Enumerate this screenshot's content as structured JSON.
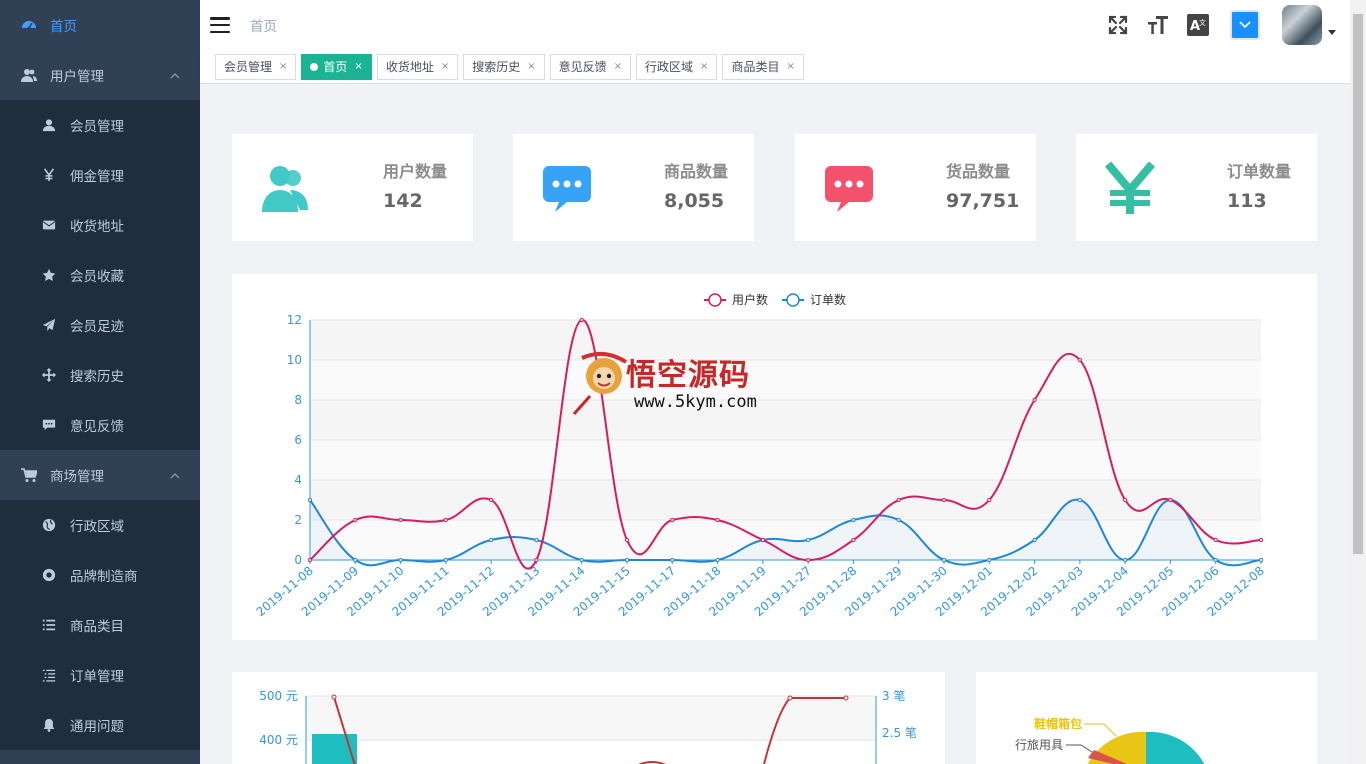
{
  "header": {
    "breadcrumb": "首页"
  },
  "sidebar": {
    "items": [
      {
        "label": "首页",
        "icon": "dashboard-icon",
        "level": "top",
        "active": true
      },
      {
        "label": "用户管理",
        "icon": "users-icon",
        "level": "top",
        "expanded": true
      },
      {
        "label": "会员管理",
        "icon": "user-icon",
        "level": "sub"
      },
      {
        "label": "佣金管理",
        "icon": "yen-icon",
        "level": "sub"
      },
      {
        "label": "收货地址",
        "icon": "envelope-icon",
        "level": "sub"
      },
      {
        "label": "会员收藏",
        "icon": "star-icon",
        "level": "sub"
      },
      {
        "label": "会员足迹",
        "icon": "paper-plane-icon",
        "level": "sub"
      },
      {
        "label": "搜索历史",
        "icon": "move-icon",
        "level": "sub"
      },
      {
        "label": "意见反馈",
        "icon": "comment-icon",
        "level": "sub"
      },
      {
        "label": "商场管理",
        "icon": "cart-icon",
        "level": "top",
        "expanded": true
      },
      {
        "label": "行政区域",
        "icon": "globe-icon",
        "level": "sub"
      },
      {
        "label": "品牌制造商",
        "icon": "support-icon",
        "level": "sub"
      },
      {
        "label": "商品类目",
        "icon": "list-icon",
        "level": "sub"
      },
      {
        "label": "订单管理",
        "icon": "list-ol-icon",
        "level": "sub"
      },
      {
        "label": "通用问题",
        "icon": "bell-icon",
        "level": "sub"
      }
    ]
  },
  "tags": [
    {
      "label": "会员管理",
      "active": false
    },
    {
      "label": "首页",
      "active": true
    },
    {
      "label": "收货地址",
      "active": false
    },
    {
      "label": "搜索历史",
      "active": false
    },
    {
      "label": "意见反馈",
      "active": false
    },
    {
      "label": "行政区域",
      "active": false
    },
    {
      "label": "商品类目",
      "active": false
    }
  ],
  "tag_close": "×",
  "stats": [
    {
      "label": "用户数量",
      "value": "142",
      "icon": "people-icon",
      "color": "#40c9c6"
    },
    {
      "label": "商品数量",
      "value": "8,055",
      "icon": "message-icon",
      "color": "#36a3f7"
    },
    {
      "label": "货品数量",
      "value": "97,751",
      "icon": "message-icon",
      "color": "#f4516c"
    },
    {
      "label": "订单数量",
      "value": "113",
      "icon": "yen-icon",
      "color": "#34bfa3"
    }
  ],
  "watermark": {
    "title": "悟空源码",
    "url": "www.5kym.com"
  },
  "colors": {
    "sidebar_bg": "#304156",
    "submenu_bg": "#1f2d3d",
    "active_tag": "#1ab394",
    "axis": "#3398DB"
  },
  "chart_data": [
    {
      "type": "line",
      "x": [
        "2019-11-08",
        "2019-11-09",
        "2019-11-10",
        "2019-11-11",
        "2019-11-12",
        "2019-11-13",
        "2019-11-14",
        "2019-11-15",
        "2019-11-17",
        "2019-11-18",
        "2019-11-19",
        "2019-11-27",
        "2019-11-28",
        "2019-11-29",
        "2019-11-30",
        "2019-12-01",
        "2019-12-02",
        "2019-12-03",
        "2019-12-04",
        "2019-12-05",
        "2019-12-06",
        "2019-12-08"
      ],
      "series": [
        {
          "name": "用户数",
          "color": "#d81b60",
          "values": [
            0,
            2,
            2,
            2,
            3,
            0,
            12,
            1,
            2,
            2,
            1,
            0,
            1,
            3,
            3,
            3,
            8,
            10,
            3,
            3,
            1,
            1
          ]
        },
        {
          "name": "订单数",
          "color": "#1e88d6",
          "values": [
            3,
            0,
            0,
            0,
            1,
            1,
            0,
            0,
            0,
            0,
            1,
            1,
            2,
            2,
            0,
            0,
            1,
            3,
            0,
            3,
            0,
            0
          ]
        }
      ],
      "ylim": [
        0,
        12
      ],
      "yticks": [
        0,
        2,
        4,
        6,
        8,
        10,
        12
      ],
      "legend": "top-center",
      "grid": true
    },
    {
      "type": "bar",
      "yticks_left": [
        "500 元",
        "400 元"
      ],
      "yticks_right": [
        "3 笔",
        "2.5 笔"
      ]
    },
    {
      "type": "pie",
      "labels": [
        "鞋帽箱包",
        "行旅用具"
      ],
      "colors": [
        "#e9c615",
        "#d9534f"
      ]
    }
  ]
}
